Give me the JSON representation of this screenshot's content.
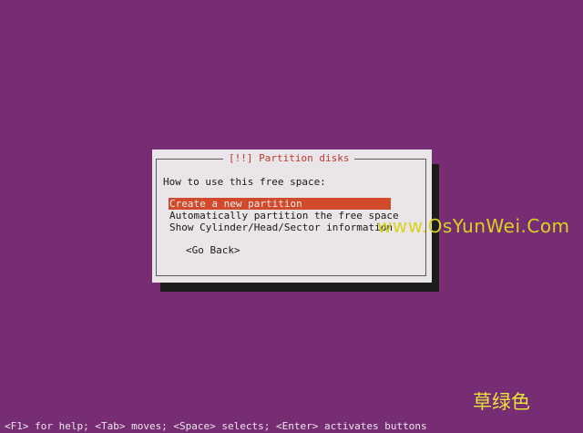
{
  "dialog": {
    "title": "[!!] Partition disks",
    "prompt": "How to use this free space:",
    "options": [
      "Create a new partition",
      "Automatically partition the free space",
      "Show Cylinder/Head/Sector information"
    ],
    "selected_index": 0,
    "back_button": "<Go Back>"
  },
  "watermark": "www.OsYunWei.Com",
  "brand_text": "草绿色",
  "status_bar": "<F1> for help; <Tab> moves; <Space> selects; <Enter> activates buttons",
  "colors": {
    "background": "#772d74",
    "dialog": "#e9e5e8",
    "title": "#c0392b",
    "selection": "#d24a2c",
    "watermark": "#d9d31e"
  }
}
